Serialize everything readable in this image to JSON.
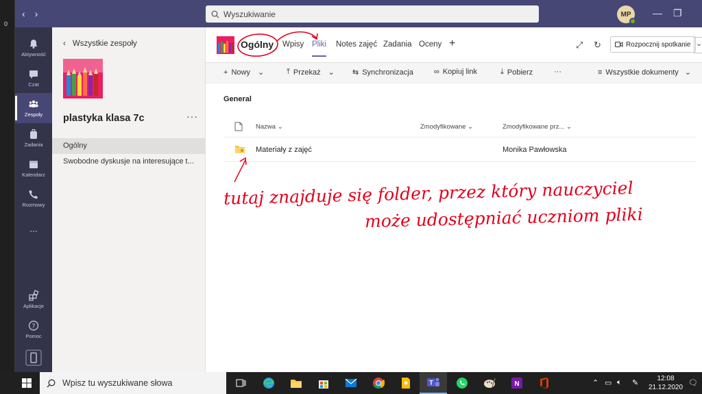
{
  "background_window": {
    "fragment_text": "0"
  },
  "titlebar": {
    "search_placeholder": "Wyszukiwanie",
    "avatar_initials": "MP"
  },
  "rail": {
    "items": [
      {
        "label": "Aktywność"
      },
      {
        "label": "Czat"
      },
      {
        "label": "Zespoły"
      },
      {
        "label": "Zadania"
      },
      {
        "label": "Kalendarz"
      },
      {
        "label": "Rozmowy"
      },
      {
        "label": "..."
      },
      {
        "label": "Aplikacje"
      },
      {
        "label": "Pomoc"
      }
    ]
  },
  "team_panel": {
    "back_label": "Wszystkie zespoły",
    "team_name": "plastyka klasa 7c",
    "more_label": "···",
    "channels": [
      {
        "label": "Ogólny"
      },
      {
        "label": "Swobodne dyskusje na interesujące t..."
      }
    ]
  },
  "header": {
    "channel_title": "Ogólny",
    "tabs": [
      {
        "label": "Wpisy"
      },
      {
        "label": "Pliki"
      },
      {
        "label": "Notes zajęć"
      },
      {
        "label": "Zadania"
      },
      {
        "label": "Oceny"
      }
    ],
    "add_tab": "+",
    "meet_label": "Rozpocznij spotkanie"
  },
  "toolbar": {
    "new": "Nowy",
    "upload": "Przekaż",
    "sync": "Synchronizacja",
    "copy_link": "Kopiuj link",
    "download": "Pobierz",
    "more": "···",
    "view": "Wszystkie dokumenty"
  },
  "files": {
    "section": "General",
    "columns": {
      "name": "Nazwa",
      "modified": "Zmodyfikowane",
      "modified_by": "Zmodyfikowane prz..."
    },
    "rows": [
      {
        "name": "Materiały z zajęć",
        "modified": "",
        "modified_by": "Monika Pawłowska"
      }
    ]
  },
  "annotation": {
    "line1": "tutaj znajduje się folder, przez który nauczyciel",
    "line2": "może udostępniać uczniom pliki",
    "color": "#e3001b"
  },
  "taskbar": {
    "search_placeholder": "Wpisz tu wyszukiwane słowa",
    "time": "12:08",
    "date": "21.12.2020"
  },
  "colors": {
    "teams_purple": "#464775",
    "rail": "#33344a",
    "accent": "#6264a7"
  }
}
